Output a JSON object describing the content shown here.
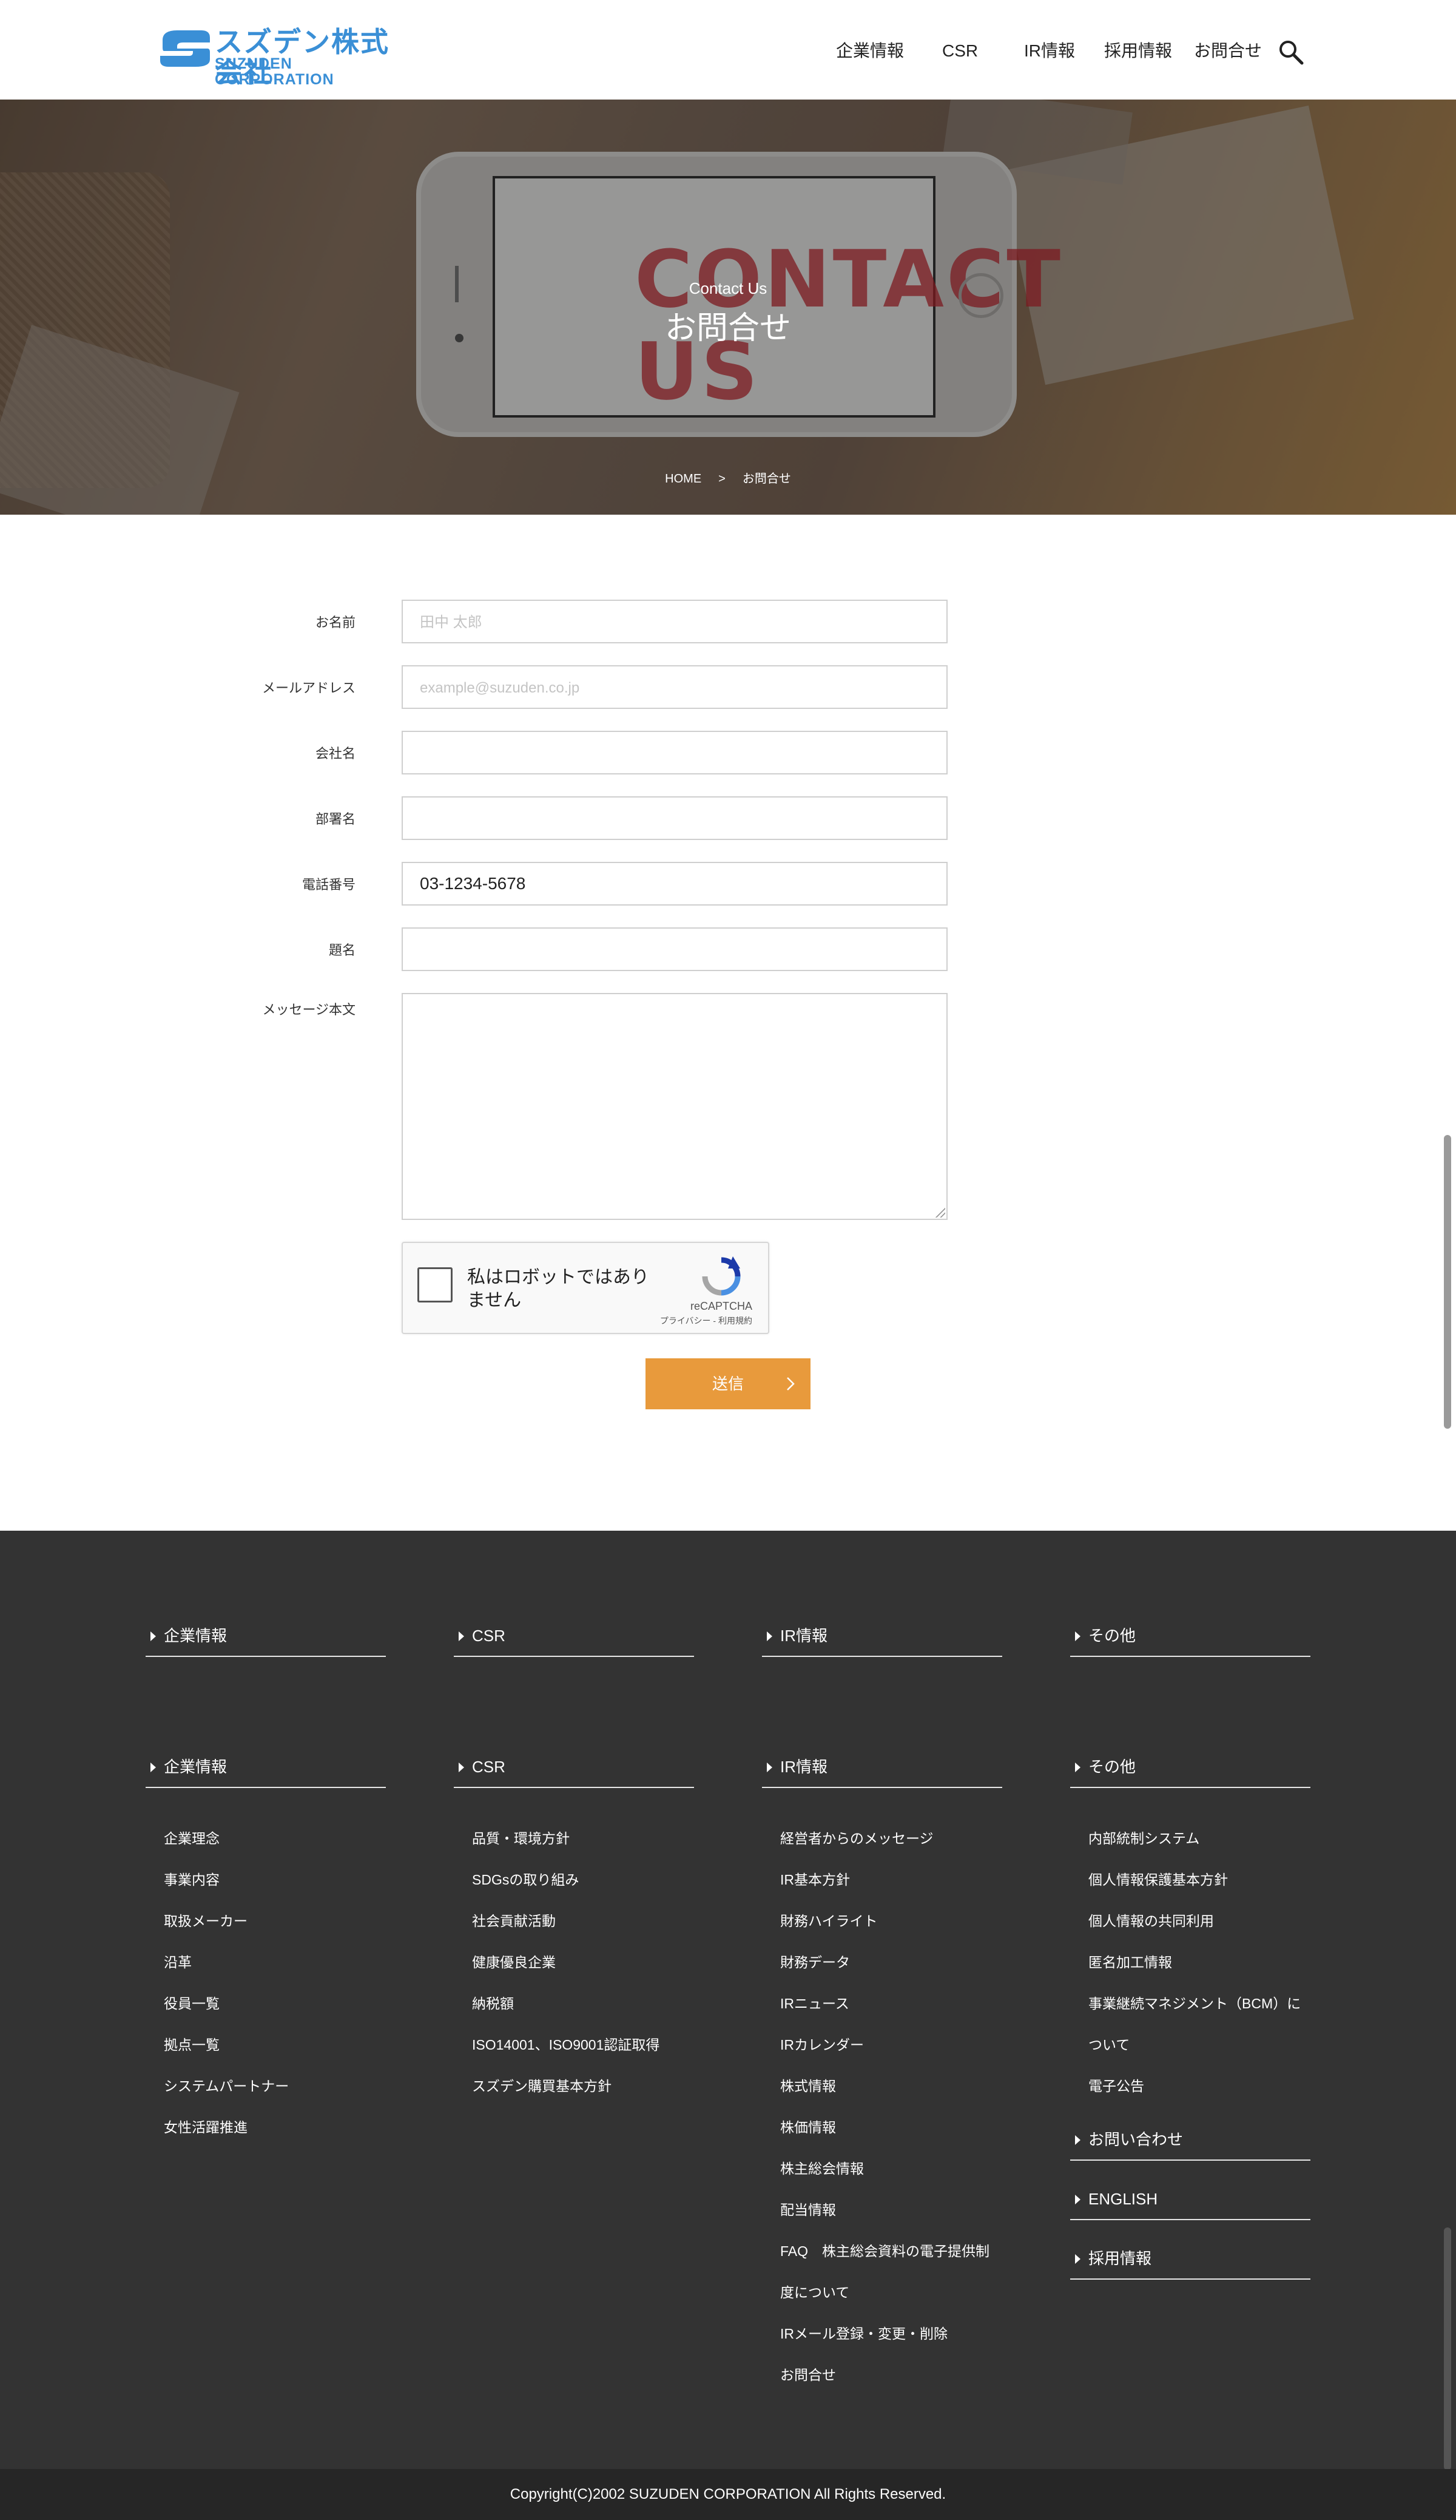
{
  "header": {
    "logo_jp": "スズデン株式会社",
    "logo_en": "SUZUDEN CORPORATION",
    "nav": [
      "企業情報",
      "CSR",
      "IR情報",
      "採用情報",
      "お問合せ"
    ]
  },
  "hero": {
    "subtitle": "Contact Us",
    "title": "お問合せ",
    "image_text": "CONTACT US",
    "breadcrumb": [
      "HOME",
      ">",
      "お問合せ"
    ]
  },
  "form": {
    "fields": [
      {
        "label": "お名前",
        "value": "",
        "placeholder": "田中 太郎"
      },
      {
        "label": "メールアドレス",
        "value": "",
        "placeholder": "example@suzuden.co.jp"
      },
      {
        "label": "会社名",
        "value": "",
        "placeholder": ""
      },
      {
        "label": "部署名",
        "value": "",
        "placeholder": ""
      },
      {
        "label": "電話番号",
        "value": "03-1234-5678",
        "placeholder": ""
      },
      {
        "label": "題名",
        "value": "",
        "placeholder": ""
      }
    ],
    "message_label": "メッセージ本文",
    "recaptcha": {
      "text": "私はロボットではありません",
      "brand": "reCAPTCHA",
      "links": "プライバシー - 利用規約"
    },
    "submit": "送信"
  },
  "footer": {
    "top_headings": [
      "企業情報",
      "CSR",
      "IR情報",
      "その他"
    ],
    "columns": [
      {
        "heading": "企業情報",
        "links": [
          "企業理念",
          "事業内容",
          "取扱メーカー",
          "沿革",
          "役員一覧",
          "拠点一覧",
          "システムパートナー",
          "女性活躍推進"
        ]
      },
      {
        "heading": "CSR",
        "links": [
          "品質・環境方針",
          "SDGsの取り組み",
          "社会貢献活動",
          "健康優良企業",
          "納税額",
          "ISO14001、ISO9001認証取得",
          "スズデン購買基本方針"
        ]
      },
      {
        "heading": "IR情報",
        "links": [
          "経営者からのメッセージ",
          "IR基本方針",
          "財務ハイライト",
          "財務データ",
          "IRニュース",
          "IRカレンダー",
          "株式情報",
          "株価情報",
          "株主総会情報",
          "配当情報",
          "FAQ　株主総会資料の電子提供制",
          "度について",
          "IRメール登録・変更・削除",
          "お問合せ"
        ]
      },
      {
        "heading": "その他",
        "links": [
          "内部統制システム",
          "個人情報保護基本方針",
          "個人情報の共同利用",
          "匿名加工情報",
          "事業継続マネジメント（BCM）に",
          "ついて",
          "電子公告"
        ]
      }
    ],
    "extra_headings": [
      "お問い合わせ",
      "ENGLISH",
      "採用情報"
    ],
    "copyright": "Copyright(C)2002 SUZUDEN CORPORATION All Rights Reserved."
  }
}
